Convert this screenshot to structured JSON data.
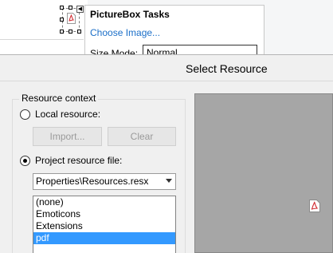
{
  "designer": {
    "tasks_panel": {
      "title": "PictureBox Tasks",
      "choose_image_link": "Choose Image...",
      "size_mode_label": "Size Mode:",
      "size_mode_value": "Normal"
    }
  },
  "dialog": {
    "title": "Select Resource",
    "resource_context_label": "Resource context",
    "local_resource_label": "Local resource:",
    "import_button": "Import...",
    "clear_button": "Clear",
    "project_resource_label": "Project resource file:",
    "project_resource_file": "Properties\\Resources.resx",
    "resource_list": [
      "(none)",
      "Emoticons",
      "Extensions",
      "pdf"
    ],
    "selected_resource": "pdf",
    "local_resource_checked": false,
    "project_resource_checked": true
  },
  "colors": {
    "link": "#1b6fc8",
    "selection": "#3399ff",
    "preview_bg": "#a6a6a6",
    "pdf_red": "#d0232a"
  },
  "icons": {
    "pdf": "pdf-file-icon",
    "smart_tag": "smart-tag-arrow-icon",
    "dropdown": "chevron-down-icon"
  }
}
